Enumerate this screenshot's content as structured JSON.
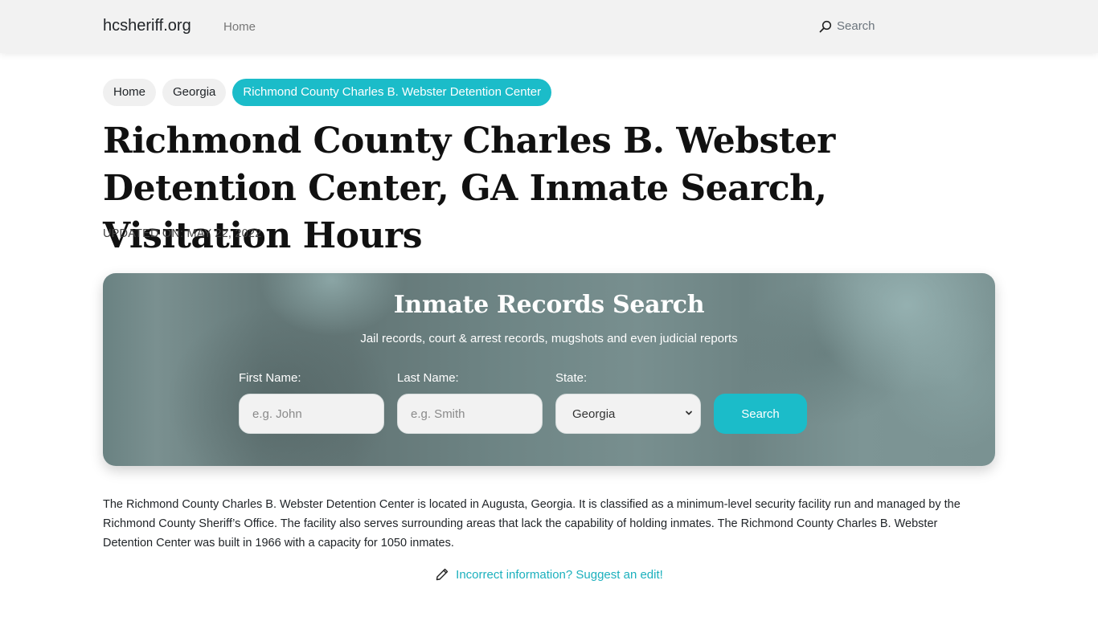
{
  "navbar": {
    "brand": "hcsheriff.org",
    "links": [
      {
        "label": "Home"
      }
    ],
    "search_label": "Search",
    "search_icon": "search-icon"
  },
  "breadcrumb": [
    {
      "label": "Home",
      "active": false
    },
    {
      "label": "Georgia",
      "active": false
    },
    {
      "label": "Richmond County Charles B. Webster Detention Center",
      "active": true
    }
  ],
  "page": {
    "title": "Richmond County Charles B. Webster Detention Center, GA Inmate Search, Visitation Hours",
    "updated": "UPDATED ON: MAY 22, 2022"
  },
  "search_card": {
    "title": "Inmate Records Search",
    "subtitle": "Jail records, court & arrest records, mugshots and even judicial reports",
    "first_name": {
      "label": "First Name:",
      "placeholder": "e.g. John",
      "value": ""
    },
    "last_name": {
      "label": "Last Name:",
      "placeholder": "e.g. Smith",
      "value": ""
    },
    "state": {
      "label": "State:",
      "selected": "Georgia"
    },
    "button_label": "Search"
  },
  "content": {
    "description": "The Richmond County Charles B. Webster Detention Center is located in Augusta, Georgia. It is classified as a minimum-level security facility run and managed by the Richmond County Sheriff’s Office. The facility also serves surrounding areas that lack the capability of holding inmates. The Richmond County Charles B. Webster Detention Center was built in 1966 with a capacity for 1050 inmates.",
    "suggest_edit": "Incorrect information? Suggest an edit!",
    "suggest_icon": "pencil-icon"
  },
  "colors": {
    "accent": "#1bbcc9",
    "navbar_bg": "#f2f2f2",
    "link": "#1bb0bd"
  }
}
